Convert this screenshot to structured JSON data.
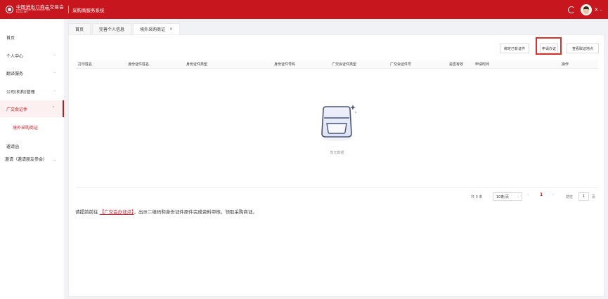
{
  "header": {
    "logo_cn": "中国进出口商品交易会",
    "logo_en": "CHINA IMPORT AND EXPORT FAIR",
    "logo_since": "Since 1957",
    "system_title": "采购商服务系统",
    "user_name": "X",
    "caret": "⌄"
  },
  "sidebar": {
    "items": [
      {
        "label": "首页"
      },
      {
        "label": "个人中心"
      },
      {
        "label": "翻译服务"
      },
      {
        "label": "公司(机构)管理"
      },
      {
        "label": "广交会证件"
      },
      {
        "label": "境外采购商证"
      },
      {
        "label": "邀请函"
      },
      {
        "label": "邀请（邀请朋友参会）"
      }
    ]
  },
  "tabs": [
    {
      "label": "首页"
    },
    {
      "label": "完善个人信息"
    },
    {
      "label": "境外采购商证",
      "close": "×"
    }
  ],
  "toolbar": {
    "bind_label": "绑定已有证件",
    "apply_label": "申请办证",
    "points_label": "查看取证地点"
  },
  "table": {
    "columns": [
      "打印姓名",
      "身份证件姓名",
      "身份证件类型",
      "身份证件号码",
      "广交会证件类型",
      "广交会证件号",
      "是否有效",
      "申请时间",
      "操作"
    ],
    "empty_text": "暂无数据"
  },
  "pagination": {
    "total": "共 0 条",
    "page_size": "10条/页",
    "prev": "‹",
    "current_page": "1",
    "next": "›",
    "goto_label": "前往",
    "goto_value": "1",
    "page_suffix": "页"
  },
  "notice": {
    "prefix": "请提前前往",
    "link": "【广交会办证点】",
    "suffix": "，出示二维码和身份证件原件完成资料审核，领取采购商证。"
  },
  "colors": {
    "brand": "#c8161e",
    "highlight_box": "#d4332e"
  }
}
